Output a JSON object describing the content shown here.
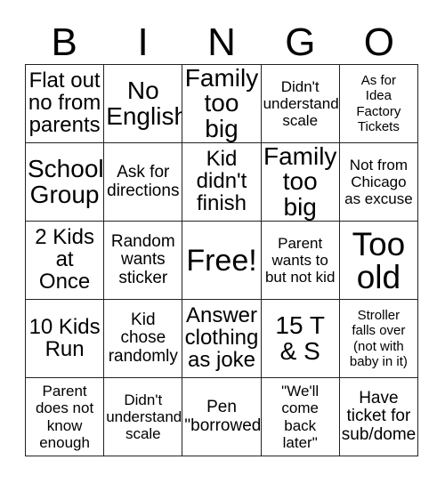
{
  "card": {
    "title": "BINGO",
    "header_letters": [
      "B",
      "I",
      "N",
      "G",
      "O"
    ],
    "border_color": "#222222",
    "text_color": "#000000",
    "background_color": "#ffffff",
    "rows": 5,
    "columns": 5,
    "cells": [
      {
        "text": "Flat out\nno from\nparents",
        "size": "fs-lg",
        "free": false
      },
      {
        "text": "No\nEnglish",
        "size": "fs-xl",
        "free": false
      },
      {
        "text": "Family\ntoo big",
        "size": "fs-xl",
        "free": false
      },
      {
        "text": "Didn't\nunderstand\nscale",
        "size": "fs-sm",
        "free": false
      },
      {
        "text": "As for\nIdea\nFactory\nTickets",
        "size": "fs-xs",
        "free": false
      },
      {
        "text": "School\nGroup",
        "size": "fs-xl",
        "free": false
      },
      {
        "text": "Ask for\ndirections",
        "size": "fs-md",
        "free": false
      },
      {
        "text": "Kid\ndidn't\nfinish",
        "size": "fs-lg",
        "free": false
      },
      {
        "text": "Family\ntoo big",
        "size": "fs-xl",
        "free": false
      },
      {
        "text": "Not from\nChicago\nas excuse",
        "size": "fs-sm",
        "free": false
      },
      {
        "text": "2 Kids\nat\nOnce",
        "size": "fs-lg",
        "free": false
      },
      {
        "text": "Random\nwants\nsticker",
        "size": "fs-md",
        "free": false
      },
      {
        "text": "Free!",
        "size": "fs-xxl",
        "free": true
      },
      {
        "text": "Parent\nwants to\nbut not kid",
        "size": "fs-sm",
        "free": false
      },
      {
        "text": "Too\nold",
        "size": "fs-huge",
        "free": false
      },
      {
        "text": "10 Kids\nRun",
        "size": "fs-lg",
        "free": false
      },
      {
        "text": "Kid\nchose\nrandomly",
        "size": "fs-md",
        "free": false
      },
      {
        "text": "Answer\nclothing\nas joke",
        "size": "fs-lg",
        "free": false
      },
      {
        "text": "15 T\n& S",
        "size": "fs-xl",
        "free": false
      },
      {
        "text": "Stroller\nfalls over\n(not with\nbaby in it)",
        "size": "fs-xs",
        "free": false
      },
      {
        "text": "Parent\ndoes not\nknow\nenough",
        "size": "fs-sm",
        "free": false
      },
      {
        "text": "Didn't\nunderstand\nscale",
        "size": "fs-sm",
        "free": false
      },
      {
        "text": "Pen\n\"borrowed\"",
        "size": "fs-md",
        "free": false
      },
      {
        "text": "\"We'll\ncome\nback\nlater\"",
        "size": "fs-sm",
        "free": false
      },
      {
        "text": "Have\nticket for\nsub/dome",
        "size": "fs-md",
        "free": false
      }
    ]
  }
}
